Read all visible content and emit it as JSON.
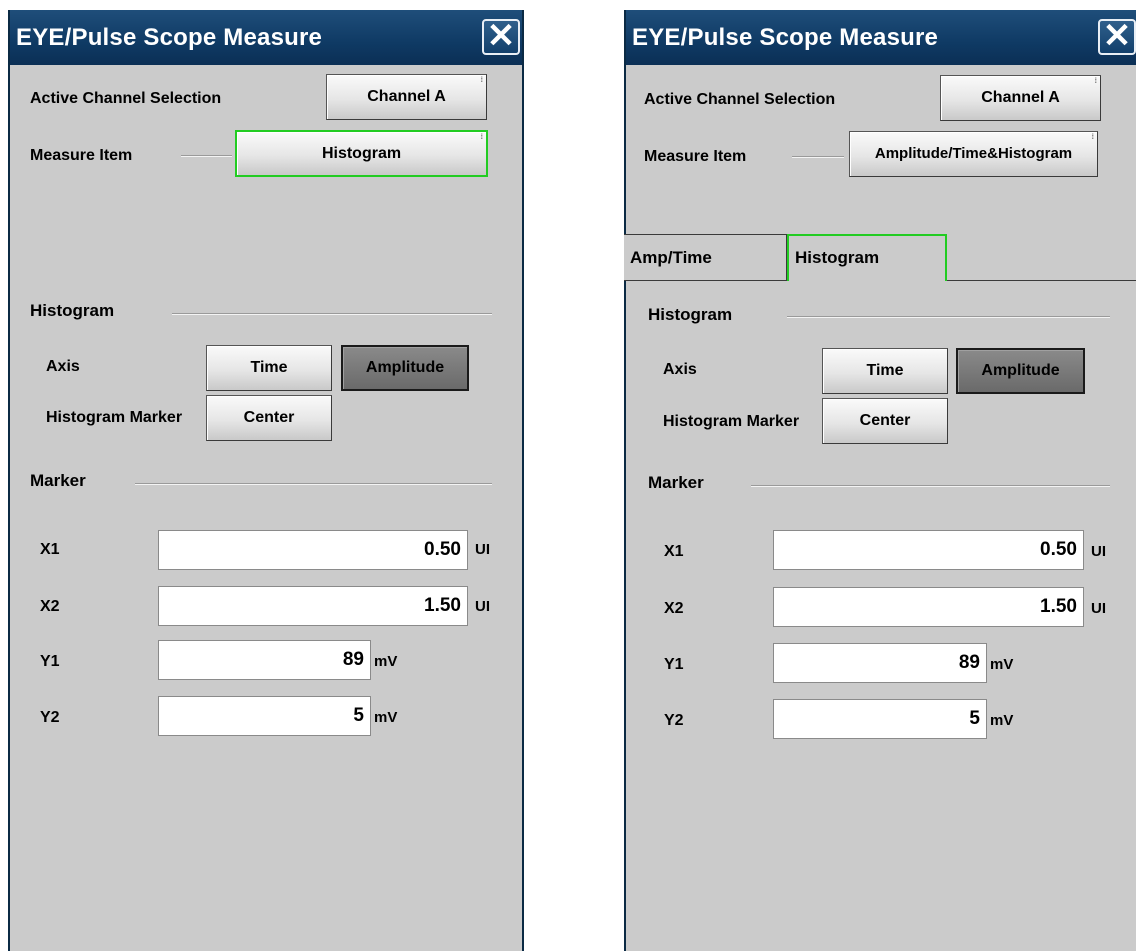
{
  "title": "EYE/Pulse Scope Measure",
  "close_label": "✕",
  "active_channel_label": "Active Channel Selection",
  "measure_item_label": "Measure Item",
  "histogram_section": "Histogram",
  "axis_label": "Axis",
  "histogram_marker_label": "Histogram Marker",
  "marker_section": "Marker",
  "axis_options": [
    "Time",
    "Amplitude"
  ],
  "axis_selected": "Amplitude",
  "markers": {
    "x1": {
      "label": "X1",
      "value": "0.50",
      "unit": "UI"
    },
    "x2": {
      "label": "X2",
      "value": "1.50",
      "unit": "UI"
    },
    "y1": {
      "label": "Y1",
      "value": "89",
      "unit": "mV"
    },
    "y2": {
      "label": "Y2",
      "value": "5",
      "unit": "mV"
    }
  },
  "left": {
    "channel_button": "Channel A",
    "measure_button": "Histogram",
    "time_button": "Time",
    "amplitude_button": "Amplitude",
    "center_button": "Center"
  },
  "right": {
    "channel_button": "Channel A",
    "measure_button": "Amplitude/Time&Histogram",
    "tabs": [
      "Amp/Time",
      "Histogram"
    ],
    "active_tab": "Histogram",
    "time_button": "Time",
    "amplitude_button": "Amplitude",
    "center_button": "Center"
  },
  "colors": {
    "title_bar": "#0f3a64",
    "panel_bg": "#cbcbcb",
    "selection_green": "#22cc22",
    "selected_button": "#6a6a6a"
  }
}
